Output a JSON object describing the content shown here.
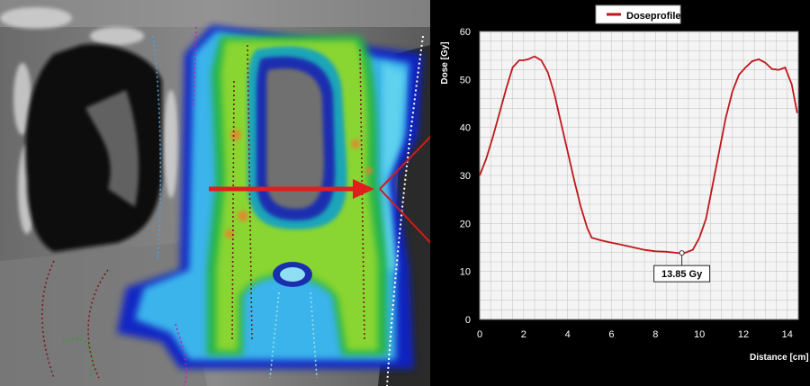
{
  "colors": {
    "curve": "#c0171b",
    "arrow": "#e01e1e",
    "plot_bg": "#f4f4f4",
    "grid": "#c8c8c8",
    "chart_bg": "#000000"
  },
  "chart_data": {
    "type": "line",
    "legend": {
      "label": "Doseprofile",
      "position": "top"
    },
    "ylabel": "Dose [Gy]",
    "xlabel": "Distance [cm]",
    "xlim": [
      0,
      14.5
    ],
    "ylim": [
      0,
      60
    ],
    "xticks": [
      0,
      2,
      4,
      6,
      8,
      10,
      12,
      14
    ],
    "yticks": [
      0,
      10,
      20,
      30,
      40,
      50,
      60
    ],
    "grid": true,
    "series": [
      {
        "name": "Doseprofile",
        "x": [
          0,
          0.3,
          0.6,
          0.9,
          1.2,
          1.5,
          1.8,
          2.0,
          2.2,
          2.5,
          2.8,
          3.1,
          3.4,
          3.7,
          4.0,
          4.3,
          4.6,
          4.9,
          5.1,
          5.5,
          6.0,
          6.5,
          7.0,
          7.5,
          8.0,
          8.5,
          9.0,
          9.3,
          9.7,
          10.0,
          10.3,
          10.6,
          10.9,
          11.2,
          11.5,
          11.8,
          12.1,
          12.4,
          12.7,
          13.0,
          13.3,
          13.6,
          13.9,
          14.2,
          14.45
        ],
        "y": [
          30,
          33.5,
          38,
          43,
          48,
          52.5,
          54,
          54,
          54.2,
          54.8,
          54,
          51.5,
          47,
          41,
          35,
          29,
          23.5,
          19,
          17,
          16.5,
          16,
          15.5,
          15,
          14.5,
          14.2,
          14.1,
          13.85,
          13.8,
          14.5,
          17,
          21,
          28,
          35,
          42,
          47.5,
          51,
          52.5,
          53.8,
          54.2,
          53.5,
          52.2,
          52,
          52.5,
          49,
          43
        ]
      }
    ],
    "annotation": {
      "text": "13.85 Gy",
      "x": 9.2,
      "y": 13.85
    }
  }
}
